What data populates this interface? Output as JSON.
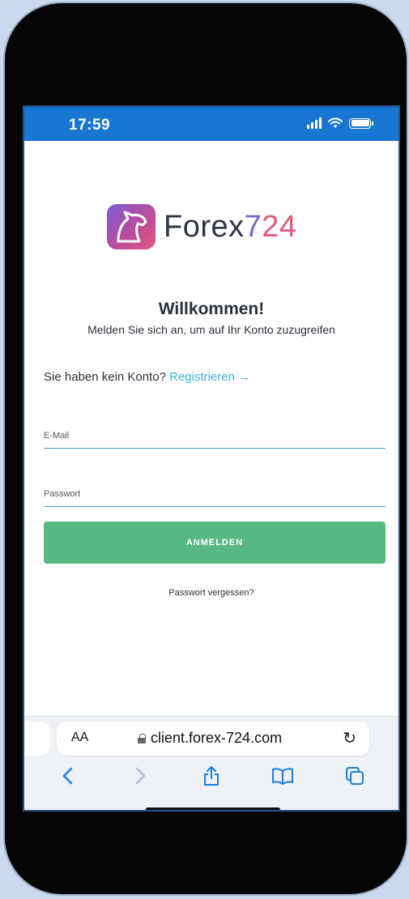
{
  "status": {
    "time": "17:59"
  },
  "brand": {
    "name_part": "Forex",
    "num_part1": "7",
    "num_part2": "24",
    "gradient_start": "#7b5bd6",
    "gradient_end": "#e05a7a"
  },
  "welcome": {
    "title": "Willkommen!",
    "subtitle": "Melden Sie sich an, um auf Ihr Konto zuzugreifen"
  },
  "register": {
    "prompt": "Sie haben kein Konto?",
    "link_label": "Registrieren →"
  },
  "form": {
    "email_placeholder": "E-Mail",
    "password_placeholder": "Passwort",
    "submit_label": "ANMELDEN",
    "submit_color": "#57b884",
    "forgot_label": "Passwort vergessen?"
  },
  "browser": {
    "text_size_label": "AA",
    "url": "client.forex-724.com",
    "nav_icons": [
      "back-icon",
      "forward-icon",
      "share-icon",
      "bookmarks-icon",
      "tabs-icon"
    ]
  },
  "theme": {
    "statusbar_color": "#1976d2",
    "link_color": "#3bb3e6"
  }
}
